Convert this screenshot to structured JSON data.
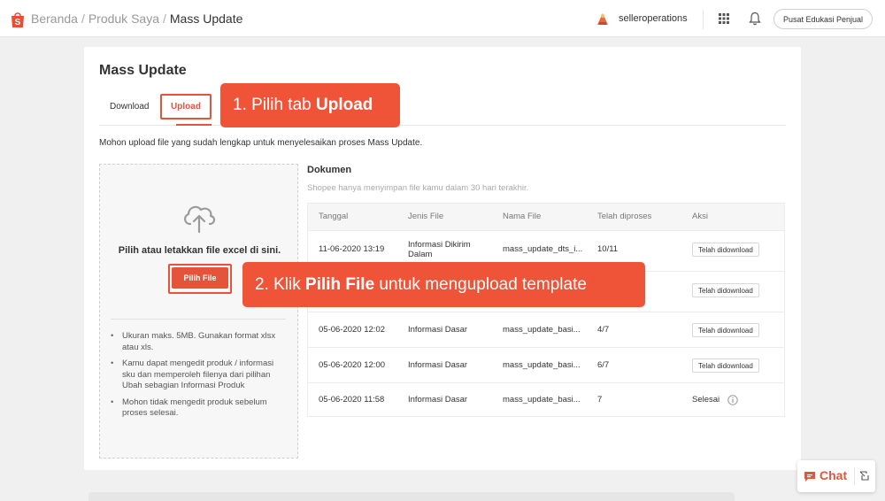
{
  "header": {
    "breadcrumb": [
      "Beranda",
      "Produk Saya",
      "Mass Update"
    ],
    "separator": "/",
    "username": "selleroperations",
    "education_button": "Pusat Edukasi Penjual"
  },
  "page": {
    "title": "Mass Update",
    "tabs": {
      "download": "Download",
      "upload": "Upload"
    },
    "note": "Mohon upload file yang sudah lengkap untuk menyelesaikan proses Mass Update."
  },
  "dropzone": {
    "text": "Pilih atau letakkan file excel di sini.",
    "button": "Pilih File",
    "bullets": [
      "Ukuran maks. 5MB. Gunakan format xlsx atau xls.",
      "Kamu dapat mengedit produk / informasi sku dan memperoleh filenya dari pilihan Ubah sebagian Informasi Produk",
      "Mohon tidak mengedit produk sebelum proses selesai."
    ]
  },
  "documents": {
    "title": "Dokumen",
    "subtitle": "Shopee hanya menyimpan file kamu dalam 30 hari terakhir.",
    "columns": [
      "Tanggal",
      "Jenis File",
      "Nama File",
      "Telah diproses",
      "Aksi"
    ],
    "rows": [
      {
        "date": "11-06-2020 13:19",
        "type": "Informasi Dikirim Dalam",
        "name": "mass_update_dts_i...",
        "processed": "10/11",
        "action": "Telah didownload"
      },
      {
        "date": "",
        "type": "",
        "name": "",
        "processed": "",
        "action": "Telah didownload"
      },
      {
        "date": "05-06-2020 12:02",
        "type": "Informasi Dasar",
        "name": "mass_update_basi...",
        "processed": "4/7",
        "action": "Telah didownload"
      },
      {
        "date": "05-06-2020 12:00",
        "type": "Informasi Dasar",
        "name": "mass_update_basi...",
        "processed": "6/7",
        "action": "Telah didownload"
      },
      {
        "date": "05-06-2020 11:58",
        "type": "Informasi Dasar",
        "name": "mass_update_basi...",
        "processed": "7",
        "action": "Selesai"
      }
    ]
  },
  "callouts": {
    "step1_prefix": "1. Pilih tab ",
    "step1_bold": "Upload",
    "step2_prefix": "2. Klik ",
    "step2_bold": "Pilih File",
    "step2_suffix": " untuk mengupload template"
  },
  "chat": {
    "label": "Chat"
  },
  "colors": {
    "accent": "#ee4d2d",
    "callout": "#ef5438"
  },
  "icons": [
    "shopee-logo-icon",
    "avatar-icon",
    "apps-grid-icon",
    "bell-icon",
    "cloud-upload-icon",
    "info-icon",
    "chat-icon",
    "minimize-icon"
  ]
}
